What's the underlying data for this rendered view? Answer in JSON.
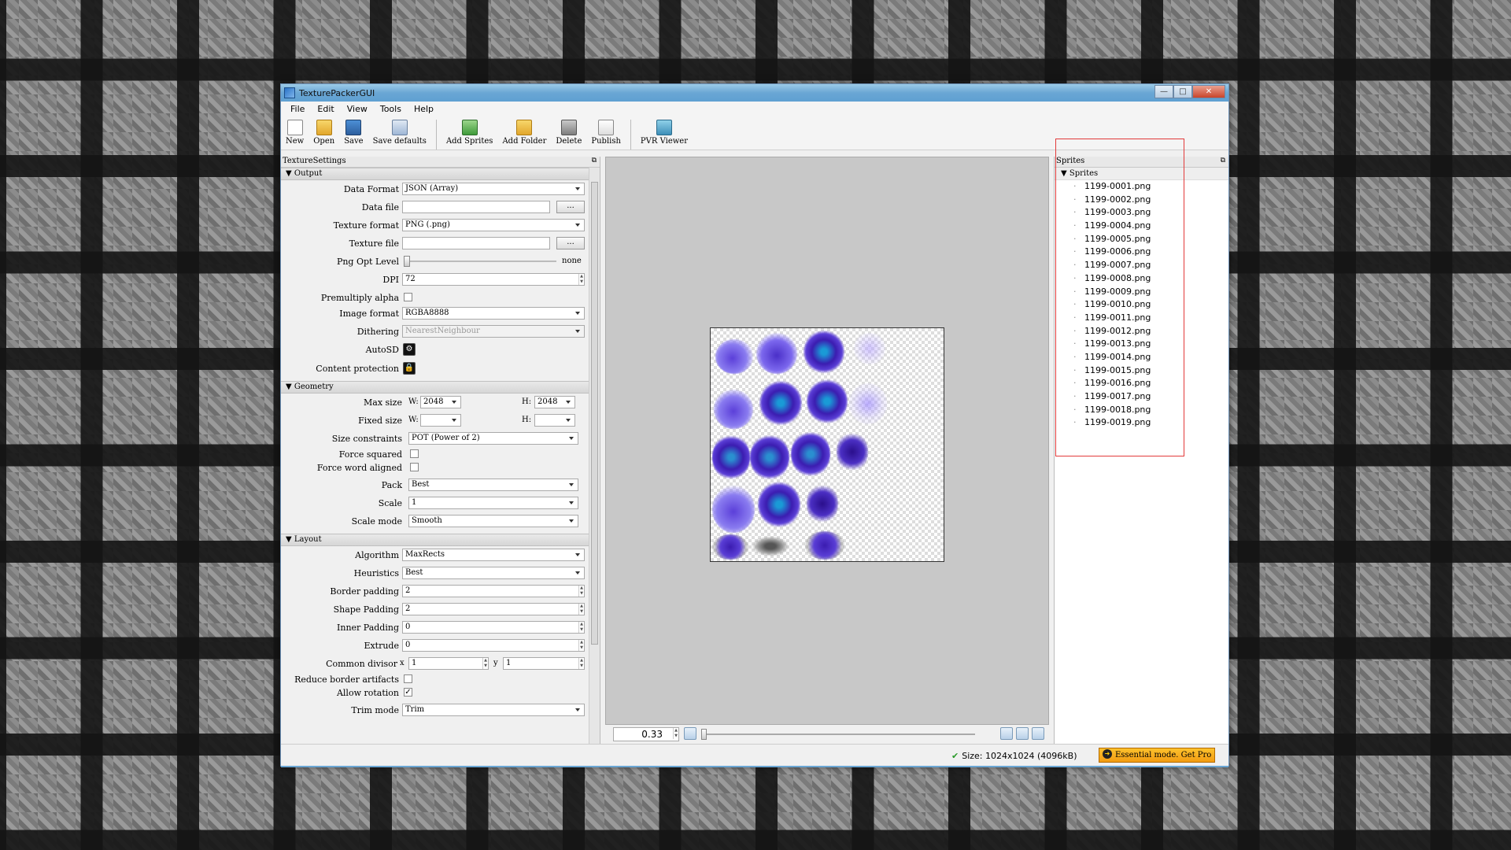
{
  "window": {
    "title": "TexturePackerGUI",
    "minimize": "—",
    "maximize": "□",
    "close": "✕"
  },
  "menu": [
    "File",
    "Edit",
    "View",
    "Tools",
    "Help"
  ],
  "toolbar": {
    "new": "New",
    "open": "Open",
    "save": "Save",
    "save_defaults": "Save defaults",
    "add_sprites": "Add Sprites",
    "add_folder": "Add Folder",
    "delete": "Delete",
    "publish": "Publish",
    "pvr_viewer": "PVR Viewer"
  },
  "texture_settings": {
    "panel_title": "TextureSettings",
    "output": {
      "section": "Output",
      "data_format_label": "Data Format",
      "data_format": "JSON (Array)",
      "data_file_label": "Data file",
      "data_file": "",
      "browse": "...",
      "texture_format_label": "Texture format",
      "texture_format": "PNG (.png)",
      "texture_file_label": "Texture file",
      "texture_file": "",
      "png_opt_label": "Png Opt Level",
      "png_opt_value": "none",
      "dpi_label": "DPI",
      "dpi": "72",
      "premultiply_label": "Premultiply alpha",
      "premultiply": false,
      "image_format_label": "Image format",
      "image_format": "RGBA8888",
      "dithering_label": "Dithering",
      "dithering": "NearestNeighbour",
      "autosd_label": "AutoSD",
      "content_protection_label": "Content protection"
    },
    "geometry": {
      "section": "Geometry",
      "max_size_label": "Max size",
      "w_label": "W:",
      "h_label": "H:",
      "max_w": "2048",
      "max_h": "2048",
      "fixed_size_label": "Fixed size",
      "fixed_w": "",
      "fixed_h": "",
      "size_constraints_label": "Size constraints",
      "size_constraints": "POT (Power of 2)",
      "force_squared_label": "Force squared",
      "force_squared": false,
      "force_word_label": "Force word aligned",
      "force_word": false,
      "pack_label": "Pack",
      "pack": "Best",
      "scale_label": "Scale",
      "scale": "1",
      "scale_mode_label": "Scale mode",
      "scale_mode": "Smooth"
    },
    "layout": {
      "section": "Layout",
      "algorithm_label": "Algorithm",
      "algorithm": "MaxRects",
      "heuristics_label": "Heuristics",
      "heuristics": "Best",
      "border_padding_label": "Border padding",
      "border_padding": "2",
      "shape_padding_label": "Shape Padding",
      "shape_padding": "2",
      "inner_padding_label": "Inner Padding",
      "inner_padding": "0",
      "extrude_label": "Extrude",
      "extrude": "0",
      "common_divisor_label": "Common divisor",
      "x_label": "x",
      "y_label": "y",
      "common_x": "1",
      "common_y": "1",
      "reduce_border_label": "Reduce border artifacts",
      "reduce_border": false,
      "allow_rotation_label": "Allow rotation",
      "allow_rotation": true,
      "trim_mode_label": "Trim mode",
      "trim_mode": "Trim"
    }
  },
  "preview": {
    "zoom": "0.33"
  },
  "sprites": {
    "panel_title": "Sprites",
    "root": "Sprites",
    "items": [
      "1199-0001.png",
      "1199-0002.png",
      "1199-0003.png",
      "1199-0004.png",
      "1199-0005.png",
      "1199-0006.png",
      "1199-0007.png",
      "1199-0008.png",
      "1199-0009.png",
      "1199-0010.png",
      "1199-0011.png",
      "1199-0012.png",
      "1199-0013.png",
      "1199-0014.png",
      "1199-0015.png",
      "1199-0016.png",
      "1199-0017.png",
      "1199-0018.png",
      "1199-0019.png"
    ]
  },
  "status": {
    "size": "Size: 1024x1024 (4096kB)",
    "pro_button": "Essential mode. Get Pro"
  }
}
